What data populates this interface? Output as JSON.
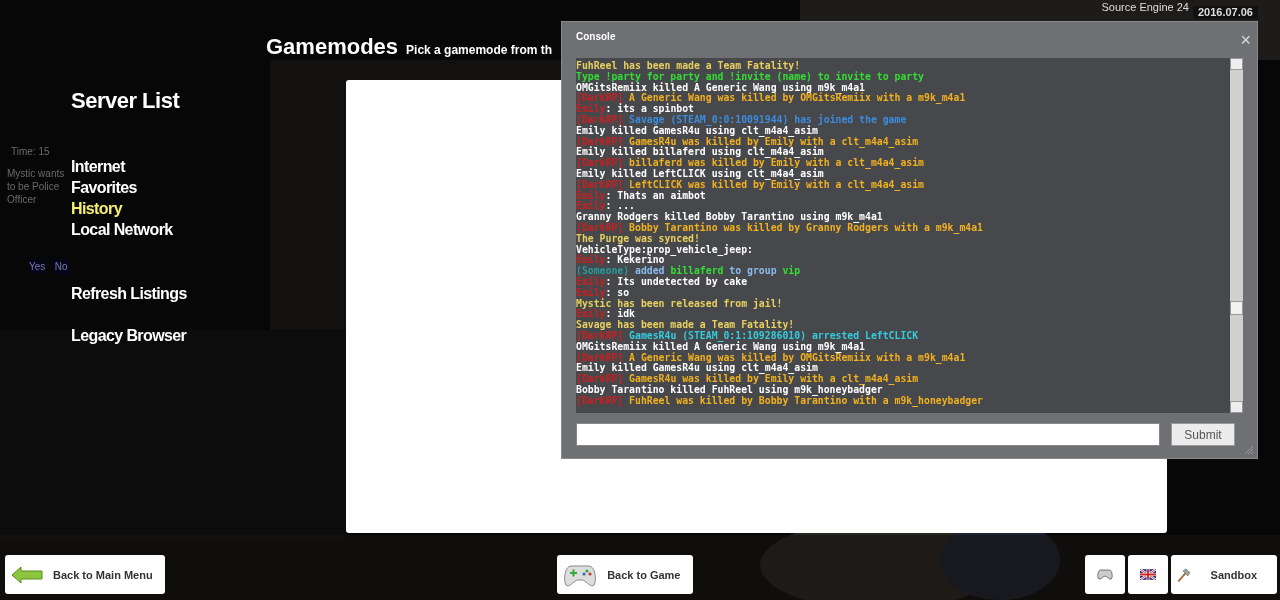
{
  "engine_info": {
    "version": "Source Engine 24",
    "date": "2016.07.06"
  },
  "hud": {
    "time": "Time: 15",
    "vote_text": "Mystic wants to be Police Officer",
    "vote_buttons": [
      "Yes",
      "No"
    ]
  },
  "sidebar": {
    "title": "Server List",
    "items": [
      {
        "label": "Internet",
        "selected": false
      },
      {
        "label": "Favorites",
        "selected": false
      },
      {
        "label": "History",
        "selected": true
      },
      {
        "label": "Local Network",
        "selected": false
      }
    ],
    "actions": [
      "Refresh Listings",
      "Legacy Browser"
    ]
  },
  "gamemodes": {
    "title": "Gamemodes",
    "subtitle": "Pick a gamemode from th"
  },
  "console": {
    "title": "Console",
    "close": "×",
    "lines": [
      {
        "segments": [
          {
            "text": "FuhReel has been made a Team Fatality!",
            "color": "#e8d060"
          }
        ]
      },
      {
        "segments": [
          {
            "text": "Type !party for party and !invite (name) to invite to party",
            "color": "#33dd33"
          }
        ]
      },
      {
        "segments": [
          {
            "text": "OMGitsRemiix killed A Generic Wang using m9k_m4a1",
            "color": "#ffffff"
          }
        ]
      },
      {
        "segments": [
          {
            "text": "[DarkRP] ",
            "color": "#c82020"
          },
          {
            "text": "A Generic Wang was killed by OMGitsRemiix with a m9k_m4a1",
            "color": "#f0b020"
          }
        ]
      },
      {
        "segments": [
          {
            "text": "Emily",
            "color": "#c82020"
          },
          {
            "text": ": its a spinbot",
            "color": "#ffffff"
          }
        ]
      },
      {
        "segments": [
          {
            "text": "[DarkRP] ",
            "color": "#c82020"
          },
          {
            "text": "Savage (STEAM_0:0:10091944) has joined the game",
            "color": "#3b8cdc"
          }
        ]
      },
      {
        "segments": [
          {
            "text": "Emily killed GamesR4u using clt_m4a4_asim",
            "color": "#ffffff"
          }
        ]
      },
      {
        "segments": [
          {
            "text": "[DarkRP] ",
            "color": "#c82020"
          },
          {
            "text": "GamesR4u was killed by Emily with a clt_m4a4_asim",
            "color": "#f0b020"
          }
        ]
      },
      {
        "segments": [
          {
            "text": "Emily killed billaferd using clt_m4a4_asim",
            "color": "#ffffff"
          }
        ]
      },
      {
        "segments": [
          {
            "text": "[DarkRP] ",
            "color": "#c82020"
          },
          {
            "text": "billaferd was killed by Emily with a clt_m4a4_asim",
            "color": "#f0b020"
          }
        ]
      },
      {
        "segments": [
          {
            "text": "Emily killed LeftCLICK using clt_m4a4_asim",
            "color": "#ffffff"
          }
        ]
      },
      {
        "segments": [
          {
            "text": "[DarkRP] ",
            "color": "#c82020"
          },
          {
            "text": "LeftCLICK was killed by Emily with a clt_m4a4_asim",
            "color": "#f0b020"
          }
        ]
      },
      {
        "segments": [
          {
            "text": "Emily",
            "color": "#c82020"
          },
          {
            "text": ": Thats an aimbot",
            "color": "#ffffff"
          }
        ]
      },
      {
        "segments": [
          {
            "text": "Emily",
            "color": "#c82020"
          },
          {
            "text": ": ...",
            "color": "#ffffff"
          }
        ]
      },
      {
        "segments": [
          {
            "text": "Granny Rodgers killed Bobby Tarantino using m9k_m4a1",
            "color": "#ffffff"
          }
        ]
      },
      {
        "segments": [
          {
            "text": "[DarkRP] ",
            "color": "#c82020"
          },
          {
            "text": "Bobby Tarantino was killed by Granny Rodgers with a m9k_m4a1",
            "color": "#f0b020"
          }
        ]
      },
      {
        "segments": [
          {
            "text": "The Purge was synced!",
            "color": "#e8d060"
          }
        ]
      },
      {
        "segments": [
          {
            "text": "VehicleType:prop_vehicle_jeep:",
            "color": "#ffffff"
          }
        ]
      },
      {
        "segments": [
          {
            "text": "Emily",
            "color": "#c82020"
          },
          {
            "text": ": Kekerino",
            "color": "#ffffff"
          }
        ]
      },
      {
        "segments": [
          {
            "text": "(Someone) ",
            "color": "#2a9a9a"
          },
          {
            "text": "added ",
            "color": "#88bbee"
          },
          {
            "text": "billaferd ",
            "color": "#33dd33"
          },
          {
            "text": "to group ",
            "color": "#88bbee"
          },
          {
            "text": "vip",
            "color": "#33dd33"
          }
        ]
      },
      {
        "segments": [
          {
            "text": "Emily",
            "color": "#c82020"
          },
          {
            "text": ": Its undetected by cake",
            "color": "#ffffff"
          }
        ]
      },
      {
        "segments": [
          {
            "text": "Emily",
            "color": "#c82020"
          },
          {
            "text": ": so",
            "color": "#ffffff"
          }
        ]
      },
      {
        "segments": [
          {
            "text": "Mystic has been released from jail!",
            "color": "#e8d060"
          }
        ]
      },
      {
        "segments": [
          {
            "text": "Emily",
            "color": "#c82020"
          },
          {
            "text": ": idk",
            "color": "#ffffff"
          }
        ]
      },
      {
        "segments": [
          {
            "text": "Savage has been made a Team Fatality!",
            "color": "#e8d060"
          }
        ]
      },
      {
        "segments": [
          {
            "text": "[DarkRP] ",
            "color": "#c82020"
          },
          {
            "text": "GamesR4u (STEAM_0:1:109286010) arrested LeftCLICK",
            "color": "#33ccdd"
          }
        ]
      },
      {
        "segments": [
          {
            "text": "OMGitsRemiix killed A Generic Wang using m9k_m4a1",
            "color": "#ffffff"
          }
        ]
      },
      {
        "segments": [
          {
            "text": "[DarkRP] ",
            "color": "#c82020"
          },
          {
            "text": "A Generic Wang was killed by OMGitsRemiix with a m9k_m4a1",
            "color": "#f0b020"
          }
        ]
      },
      {
        "segments": [
          {
            "text": "Emily killed GamesR4u using clt_m4a4_asim",
            "color": "#ffffff"
          }
        ]
      },
      {
        "segments": [
          {
            "text": "[DarkRP] ",
            "color": "#c82020"
          },
          {
            "text": "GamesR4u was killed by Emily with a clt_m4a4_asim",
            "color": "#f0b020"
          }
        ]
      },
      {
        "segments": [
          {
            "text": "Bobby Tarantino killed FuhReel using m9k_honeybadger",
            "color": "#ffffff"
          }
        ]
      },
      {
        "segments": [
          {
            "text": "[DarkRP] ",
            "color": "#c82020"
          },
          {
            "text": "FuhReel was killed by Bobby Tarantino with a m9k_honeybadger",
            "color": "#f0b020"
          }
        ]
      }
    ],
    "submit": "Submit"
  },
  "bottom_bar": {
    "back_menu": "Back to Main Menu",
    "back_game": "Back to Game",
    "gamemode": "Sandbox"
  }
}
